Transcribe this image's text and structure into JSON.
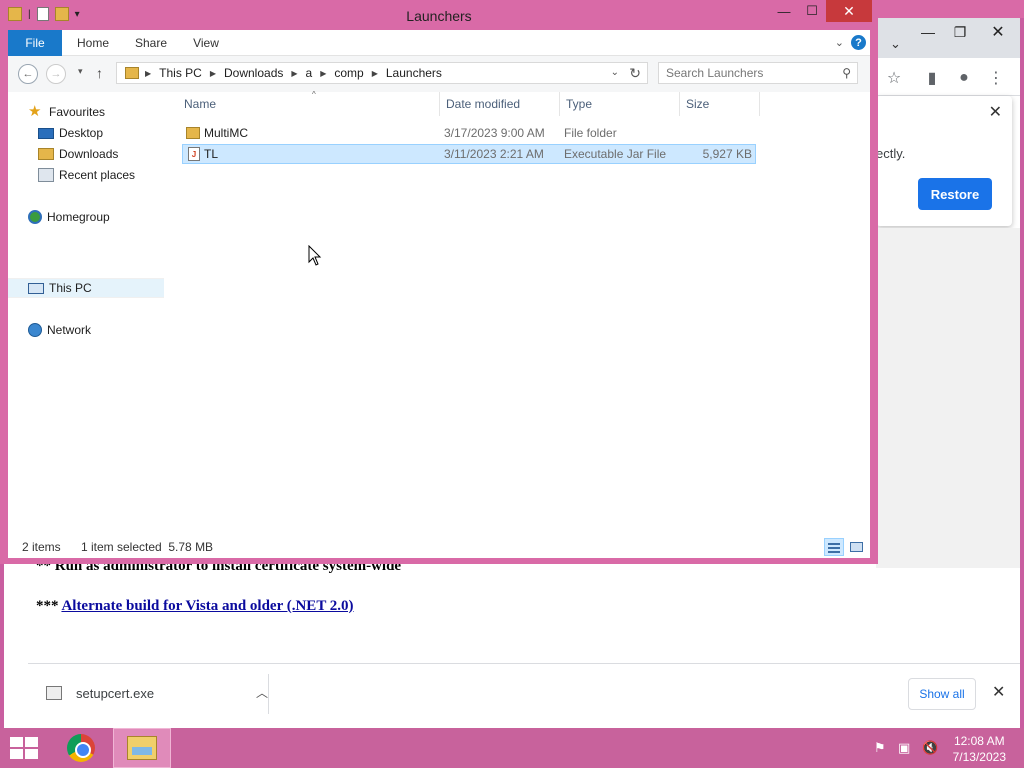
{
  "explorer": {
    "title": "Launchers",
    "ribbon_tabs": [
      "File",
      "Home",
      "Share",
      "View"
    ],
    "breadcrumb": [
      "This PC",
      "Downloads",
      "a",
      "comp",
      "Launchers"
    ],
    "search_placeholder": "Search Launchers",
    "nav": {
      "favourites": "Favourites",
      "desktop": "Desktop",
      "downloads": "Downloads",
      "recent": "Recent places",
      "homegroup": "Homegroup",
      "this_pc": "This PC",
      "network": "Network"
    },
    "columns": [
      "Name",
      "Date modified",
      "Type",
      "Size"
    ],
    "files": [
      {
        "name": "MultiMC",
        "date": "3/17/2023 9:00 AM",
        "type": "File folder",
        "size": "",
        "icon": "folder-icon",
        "selected": false
      },
      {
        "name": "TL",
        "date": "3/11/2023 2:21 AM",
        "type": "Executable Jar File",
        "size": "5,927 KB",
        "icon": "jar-icon",
        "selected": true
      }
    ],
    "status": {
      "items": "2 items",
      "selection": "1 item selected  5.78 MB"
    }
  },
  "browser": {
    "restore_message": "ectly.",
    "restore_button": "Restore",
    "line_admin": "** Run as administrator to install certificate system-wide",
    "line_alt_prefix": "***",
    "line_alt_link": "Alternate build for Vista and older (.NET 2.0)",
    "download_file": "setupcert.exe",
    "show_all": "Show all"
  },
  "taskbar": {
    "time": "12:08 AM",
    "date": "7/13/2023"
  },
  "colors": {
    "window_frame": "#d96aa7",
    "accent_blue": "#1979ca",
    "selection_bg": "#cde8ff",
    "close_red": "#c7393c"
  }
}
